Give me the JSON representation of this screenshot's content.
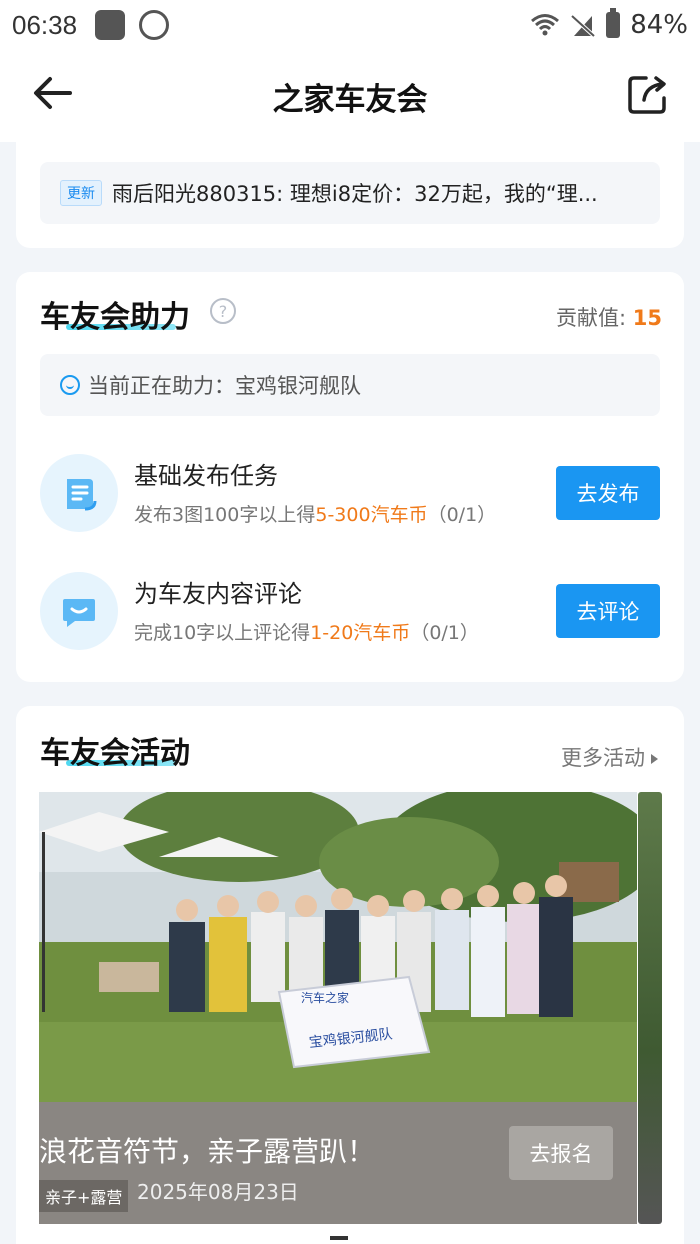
{
  "status_bar": {
    "time": "06:38",
    "battery": "84%"
  },
  "header": {
    "title": "之家车友会"
  },
  "update": {
    "tag": "更新",
    "text": "雨后阳光880315: 理想i8定价：32万起，我的“理..."
  },
  "help": {
    "title": "车友会助力",
    "help_icon": "?",
    "contrib_label": "贡献值: ",
    "contrib_value": "15",
    "assisting": "当前正在助力：宝鸡银河舰队",
    "tasks": [
      {
        "title": "基础发布任务",
        "desc_prefix": "发布3图100字以上得",
        "desc_reward": "5-300汽车币",
        "desc_progress": "（0/1）",
        "button": "去发布",
        "icon": "document-icon"
      },
      {
        "title": "为车友内容评论",
        "desc_prefix": "完成10字以上评论得",
        "desc_reward": "1-20汽车币",
        "desc_progress": "（0/1）",
        "button": "去评论",
        "icon": "comment-icon"
      }
    ]
  },
  "activity": {
    "title": "车友会活动",
    "more": "更多活动",
    "event": {
      "title": "浪花音符节，亲子露营趴！",
      "tag": "亲子+露营",
      "date": "2025年08月23日",
      "button": "去报名",
      "banner_text": "汽车之家",
      "banner_team": "宝鸡银河舰队"
    }
  },
  "colors": {
    "accent": "#1a96f2",
    "reward": "#f07a1a",
    "underline": "#4fd8f0"
  }
}
